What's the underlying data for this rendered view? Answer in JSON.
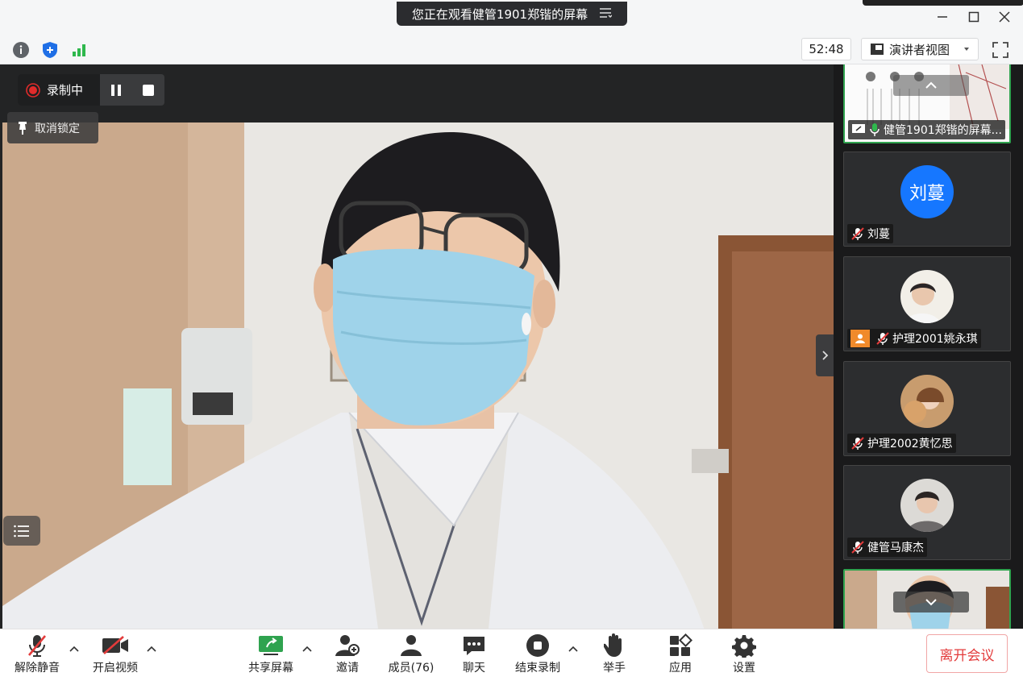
{
  "window": {
    "banner_text": "您正在观看健管1901郑锴的屏幕",
    "banner_menu_icon": "menu-icon",
    "controls": [
      "minimize-icon",
      "maximize-icon",
      "close-icon"
    ]
  },
  "infobar": {
    "icons": [
      "info-icon",
      "shield-icon",
      "signal-icon"
    ],
    "timer": "52:48",
    "view_mode": "演讲者视图",
    "accent": "#1f6fe6",
    "signal_color": "#2fb84d"
  },
  "main": {
    "recording_label": "录制中",
    "unpin_label": "取消锁定",
    "rec_color": "#e02b2b"
  },
  "sidebar": {
    "tiles": [
      {
        "name": "健管1901郑锴的屏幕...",
        "type": "screen-share",
        "active": true
      },
      {
        "name": "刘蔓",
        "avatar_text": "刘蔓",
        "avatar_color": "#1677ff",
        "muted": true
      },
      {
        "name": "护理2001姚永琪",
        "muted": true,
        "has_badge": true
      },
      {
        "name": "护理2002黄忆思",
        "muted": true
      },
      {
        "name": "健管马康杰",
        "muted": true
      },
      {
        "name": "",
        "active": true
      }
    ]
  },
  "toolbar": {
    "unmute": "解除静音",
    "start_video": "开启视频",
    "share_screen": "共享屏幕",
    "invite": "邀请",
    "members": "成员(76)",
    "chat": "聊天",
    "stop_recording": "结束录制",
    "raise_hand": "举手",
    "apps": "应用",
    "settings": "设置",
    "leave": "离开会议",
    "leave_color": "#e33b3b",
    "share_color": "#2fa34f"
  }
}
